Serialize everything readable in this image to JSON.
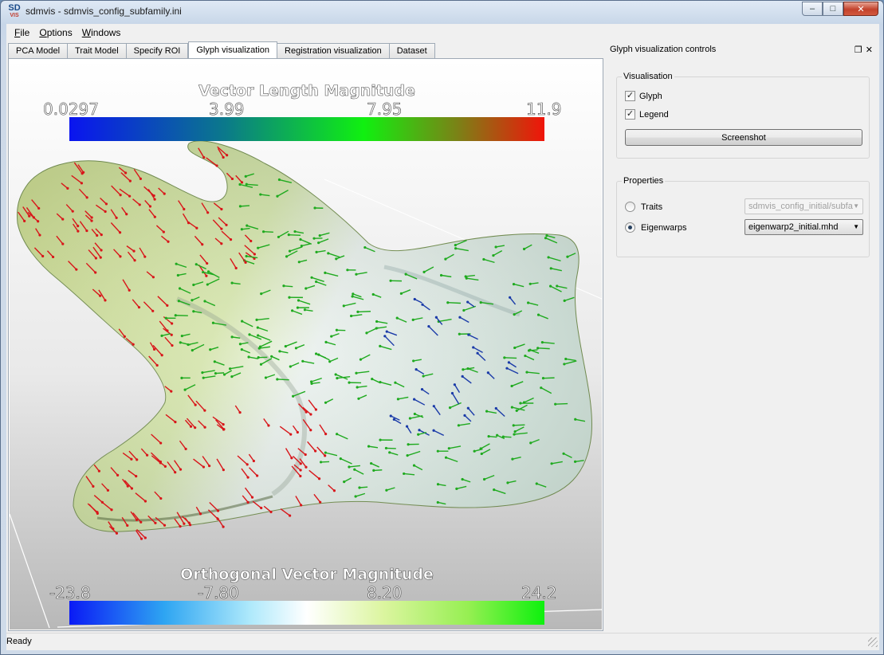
{
  "window": {
    "title": "sdmvis - sdmvis_config_subfamily.ini",
    "logo_main": "SD",
    "logo_sub": "VIS"
  },
  "menu": [
    {
      "pre": "",
      "ul": "F",
      "rest": "ile"
    },
    {
      "pre": "",
      "ul": "O",
      "rest": "ptions"
    },
    {
      "pre": "",
      "ul": "W",
      "rest": "indows"
    }
  ],
  "tabs": [
    {
      "label": "PCA Model",
      "active": false
    },
    {
      "label": "Trait Model",
      "active": false
    },
    {
      "label": "Specify ROI",
      "active": false
    },
    {
      "label": "Glyph visualization",
      "active": true
    },
    {
      "label": "Registration visualization",
      "active": false
    },
    {
      "label": "Dataset",
      "active": false
    }
  ],
  "viewport": {
    "legend_top": {
      "title": "Vector Length Magnitude",
      "ticks": [
        "0.0297",
        "3.99",
        "7.95",
        "11.9"
      ]
    },
    "legend_bottom": {
      "title": "Orthogonal Vector Magnitude",
      "ticks": [
        "-23.8",
        "-7.80",
        "8.20",
        "24.2"
      ]
    }
  },
  "dock": {
    "title": "Glyph visualization controls",
    "visualisation_group": {
      "title": "Visualisation",
      "glyph_label": "Glyph",
      "glyph_checked": true,
      "legend_label": "Legend",
      "legend_checked": true,
      "screenshot_label": "Screenshot"
    },
    "properties_group": {
      "title": "Properties",
      "traits_label": "Traits",
      "traits_value": "sdmvis_config_initial/subfa",
      "eigenwarps_label": "Eigenwarps",
      "eigenwarps_value": "eigenwarp2_initial.mhd",
      "selected": "eigenwarps"
    }
  },
  "status": {
    "text": "Ready"
  },
  "colors": {
    "glyph_red": "#d8161a",
    "glyph_green": "#1faa1f",
    "glyph_blue": "#1a3aa8",
    "surface_green": "#cfe39a",
    "surface_white": "#eef2f2"
  }
}
